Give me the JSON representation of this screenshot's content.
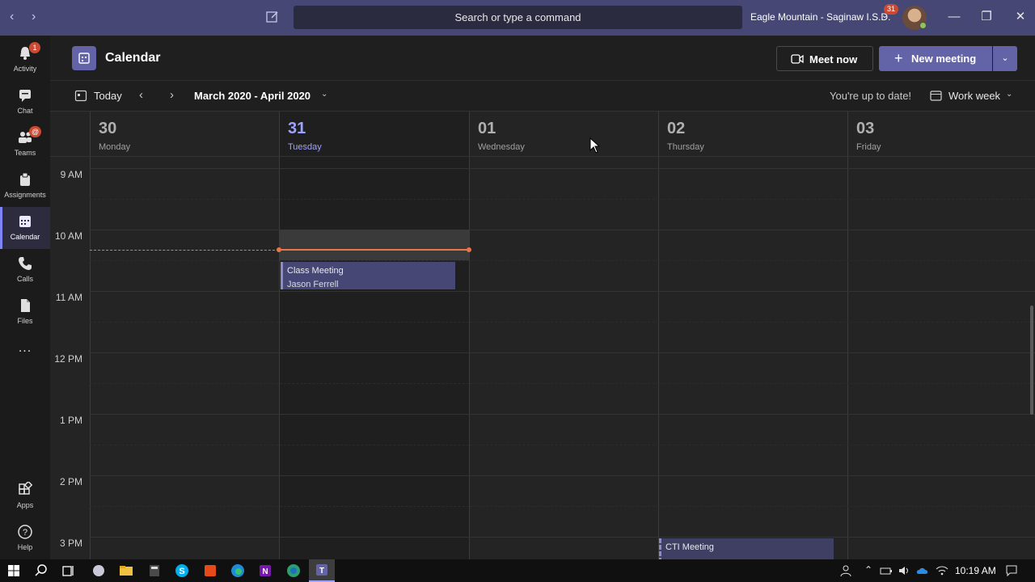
{
  "titlebar": {
    "search_placeholder": "Search or type a command",
    "org_name": "Eagle Mountain - Saginaw I.S.D.",
    "notification_count": "31"
  },
  "rail": {
    "items": [
      {
        "label": "Activity",
        "icon": "bell-icon",
        "badge": "1"
      },
      {
        "label": "Chat",
        "icon": "chat-icon"
      },
      {
        "label": "Teams",
        "icon": "teams-icon",
        "badge": "@"
      },
      {
        "label": "Assignments",
        "icon": "assignments-icon"
      },
      {
        "label": "Calendar",
        "icon": "calendar-icon",
        "active": true
      },
      {
        "label": "Calls",
        "icon": "phone-icon"
      },
      {
        "label": "Files",
        "icon": "file-icon"
      },
      {
        "label": "Apps",
        "icon": "apps-icon"
      },
      {
        "label": "Help",
        "icon": "help-icon"
      }
    ],
    "more": "..."
  },
  "header": {
    "title": "Calendar",
    "meet_now": "Meet now",
    "new_meeting": "New meeting"
  },
  "toolbar": {
    "today": "Today",
    "range": "March 2020 - April 2020",
    "status": "You're up to date!",
    "view": "Work week"
  },
  "days": [
    {
      "num": "30",
      "name": "Monday"
    },
    {
      "num": "31",
      "name": "Tuesday",
      "today": true
    },
    {
      "num": "01",
      "name": "Wednesday"
    },
    {
      "num": "02",
      "name": "Thursday"
    },
    {
      "num": "03",
      "name": "Friday"
    }
  ],
  "hours": [
    "9 AM",
    "10 AM",
    "11 AM",
    "12 PM",
    "1 PM",
    "2 PM",
    "3 PM"
  ],
  "events": [
    {
      "title": "Class Meeting",
      "organizer": "Jason Ferrell"
    },
    {
      "title": "CTI Meeting"
    }
  ],
  "taskbar": {
    "clock": "10:19 AM"
  },
  "colors": {
    "accent": "#6264a7",
    "titlebar": "#464775",
    "now_line": "#e97548",
    "today_text": "#9ea2ff"
  }
}
